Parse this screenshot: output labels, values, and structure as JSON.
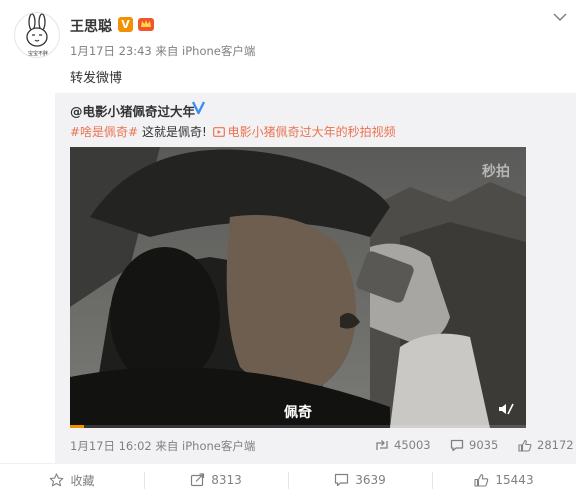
{
  "post": {
    "user_name": "王思聪",
    "verified_badge": "V",
    "avatar_caption": "宝宝不胖",
    "meta": "1月17日 23:43 来自 iPhone客户端",
    "text": "转发微博"
  },
  "repost": {
    "author": "@电影小猪佩奇过大年",
    "hashtag": "#啥是佩奇#",
    "body": " 这就是佩奇! ",
    "video_link": "电影小猪佩奇过大年的秒拍视频",
    "video": {
      "watermark": "秒拍",
      "subtitle": "佩奇",
      "progress": 0.03
    },
    "meta": "1月17日 16:02 来自 iPhone客户端",
    "stats": {
      "reposts": "45003",
      "comments": "9035",
      "likes": "28172"
    }
  },
  "actions": {
    "favorite_label": "收藏",
    "repost_count": "8313",
    "comment_count": "3639",
    "like_count": "15443"
  },
  "colors": {
    "link": "#eb7350",
    "badge": "#f29100",
    "muted": "#808080"
  },
  "icons": [
    "chevron-down-icon",
    "vip-crown-icon",
    "verified-icon",
    "video-link-icon",
    "mute-icon",
    "repost-icon",
    "comment-icon",
    "like-icon",
    "star-icon"
  ]
}
